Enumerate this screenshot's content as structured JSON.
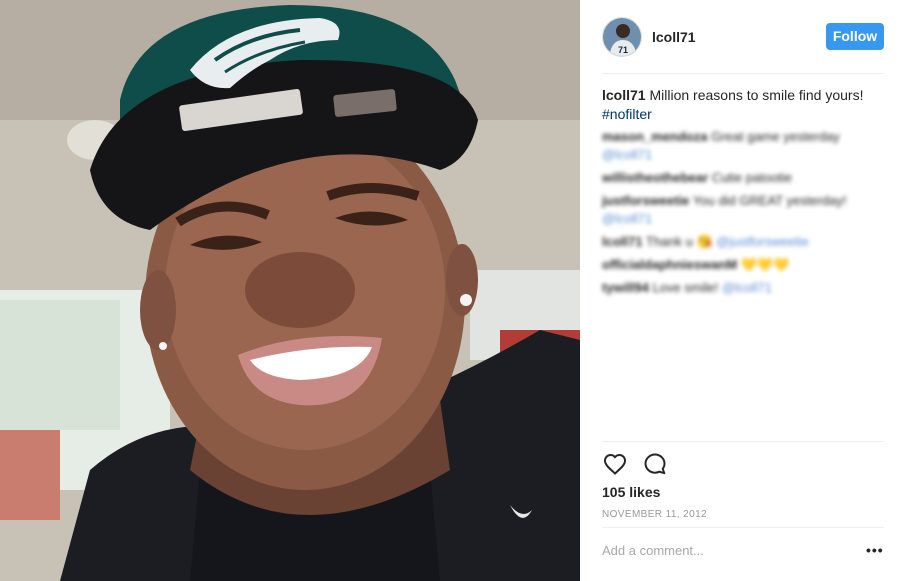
{
  "post": {
    "username": "lcoll71",
    "avatar_jersey_number": "71",
    "follow_label": "Follow",
    "caption": {
      "user": "lcoll71",
      "text": " Million reasons to smile find yours! ",
      "hashtag": "#nofilter"
    },
    "comments": [
      {
        "user": "mason_mendoza",
        "text": " Great game yesterday ",
        "mention": "@lcoll71",
        "emoji": ""
      },
      {
        "user": "willistheothebear",
        "text": " Cutie patootie",
        "mention": "",
        "emoji": ""
      },
      {
        "user": "justforsweetie",
        "text": " You did GREAT yesterday! ",
        "mention": "@lcoll71",
        "emoji": ""
      },
      {
        "user": "lcoll71",
        "text": " Thank u ",
        "mention": "@justforsweetie",
        "emoji": "😘"
      },
      {
        "user": "officialdaphnieswanM",
        "text": " ",
        "mention": "",
        "emoji": "💛💛💛"
      },
      {
        "user": "tywill94",
        "text": " Love smile! ",
        "mention": "@lcoll71",
        "emoji": ""
      }
    ],
    "likes": "105 likes",
    "date": "NOVEMBER 11, 2012",
    "add_comment_placeholder": "Add a comment...",
    "more_label": "•••"
  },
  "icons": {
    "like": "heart-icon",
    "comment": "comment-bubble-icon",
    "more": "more-options-icon"
  },
  "colors": {
    "follow_button": "#3897f0",
    "hashtag": "#003569",
    "muted_text": "#999999",
    "divider": "#efefef"
  }
}
